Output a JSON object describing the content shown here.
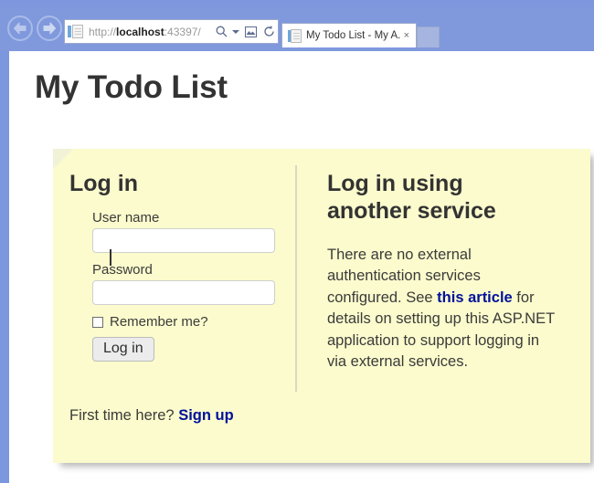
{
  "browser": {
    "back_label": "Back",
    "forward_label": "Forward",
    "url_prefix": "http://",
    "url_host": "localhost",
    "url_suffix": ":43397/",
    "url_full": "http://localhost:43397/",
    "search_icon": "search-icon",
    "dropdown_icon": "chevron-down-icon",
    "compat_icon": "compatibility-view-icon",
    "refresh_icon": "refresh-icon",
    "tab_title": "My Todo List - My A...",
    "tab_close_label": "×",
    "new_tab_label": ""
  },
  "page": {
    "title": "My Todo List"
  },
  "login": {
    "heading": "Log in",
    "username_label": "User name",
    "username_value": "",
    "username_placeholder": "",
    "password_label": "Password",
    "password_value": "",
    "password_placeholder": "",
    "remember_label": "Remember me?",
    "remember_checked": false,
    "submit_label": "Log in"
  },
  "external": {
    "heading": "Log in using another service",
    "text_before": "There are no external authentication services configured. See ",
    "link_label": "this article",
    "text_after": " for details on setting up this ASP.NET application to support logging in via external services."
  },
  "signup": {
    "prompt": "First time here? ",
    "link_label": "Sign up"
  },
  "colors": {
    "chrome_blue": "#8099dd",
    "panel_yellow": "#fbfbcd",
    "heading_dark": "#333333",
    "link_navy": "#00129b",
    "divider_gray": "#d8d8c4"
  }
}
